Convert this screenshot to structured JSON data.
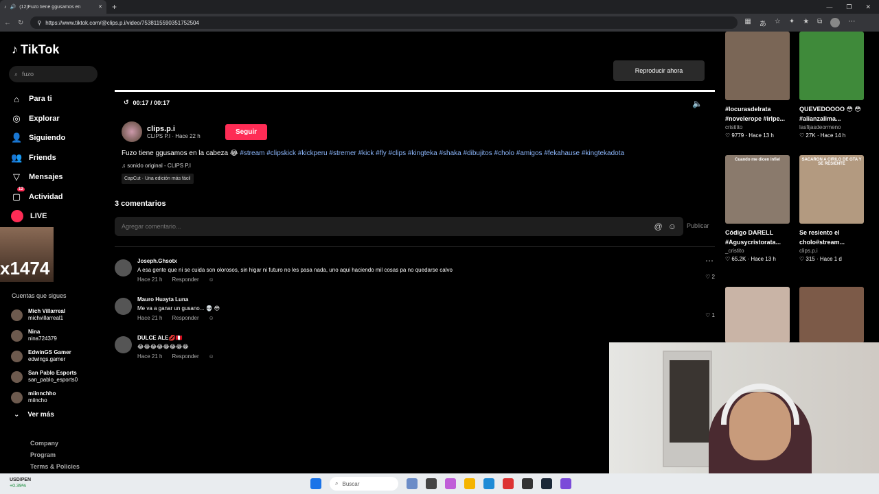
{
  "browser": {
    "tab_title": "(12)Fuzo tiene ggusamos en",
    "url": "https://www.tiktok.com/@clips.p.i/video/7538115590351752504"
  },
  "sidebar": {
    "logo": "TikTok",
    "search_placeholder": "fuzo",
    "nav": [
      {
        "label": "Para ti",
        "icon": "home-icon"
      },
      {
        "label": "Explorar",
        "icon": "compass-icon"
      },
      {
        "label": "Siguiendo",
        "icon": "following-icon"
      },
      {
        "label": "Friends",
        "icon": "friends-icon"
      },
      {
        "label": "Mensajes",
        "icon": "messages-icon"
      },
      {
        "label": "Actividad",
        "icon": "activity-icon",
        "badge": "12"
      },
      {
        "label": "LIVE",
        "icon": "live-icon"
      }
    ],
    "overlay_text": "x1474",
    "following_title": "Cuentas que sigues",
    "following": [
      {
        "name": "Mich Villarreal",
        "handle": "michvillarreal1"
      },
      {
        "name": "Nina",
        "handle": "nina724379"
      },
      {
        "name": "EdwinGS Gamer",
        "handle": "edwings.gamer"
      },
      {
        "name": "San Pablo Esports",
        "handle": "san_pablo_esports0"
      },
      {
        "name": "miinnchho",
        "handle": "miincho"
      }
    ],
    "see_more": "Ver más",
    "footer": [
      "Company",
      "Program",
      "Terms & Policies"
    ]
  },
  "video": {
    "play_now": "Reproducir ahora",
    "time": "00:17 / 00:17",
    "author_name": "clips.p.i",
    "author_sub": "CLIPS P.I · Hace 22 h",
    "follow_label": "Seguir",
    "desc_text": "Fuzo tiene ggusamos en la cabeza 😂",
    "desc_tags": "#stream #clipskick #kickperu #stremer #kick #fly #clips #kingteka #shaka #dibujitos #cholo #amigos #fekahause #kingtekadota",
    "sound": "♫ sonido original - CLIPS P.I",
    "capcut": "CapCut · Una edición más fácil"
  },
  "comments_section": {
    "count_label": "3 comentarios",
    "input_placeholder": "Agregar comentario...",
    "publish_label": "Publicar",
    "comments": [
      {
        "name": "Joseph.Ghsotx",
        "text": "A esa gente que ni se cuida son olorosos, sin higar ni futuro no les pasa nada, uno aqui haciendo mil cosas pa no quedarse calvo",
        "time": "Hace 21 h",
        "reply": "Responder",
        "likes": "2"
      },
      {
        "name": "Mauro Huayta Luna",
        "text": "Me va a ganar un gusano... 💀 😳",
        "time": "Hace 21 h",
        "reply": "Responder",
        "likes": "1"
      },
      {
        "name": "DULCE ALE💋🇵🇪",
        "text": "😂😂😂😂😂😂😂😂",
        "time": "Hace 21 h",
        "reply": "Responder",
        "likes": ""
      }
    ]
  },
  "feed": [
    {
      "title": "#locurasdelrata #novelerope #irlpe...",
      "author": "cristitto",
      "stats": "♡ 9779 · Hace 13 h",
      "color": "#7a6656"
    },
    {
      "title": "QUEVEDOOOO 😳 😳 #alianzalima...",
      "author": "lasfijasdeormeno",
      "stats": "♡ 27K · Hace 14 h",
      "color": "#3f8a3a"
    },
    {
      "title": "Código DARELL #Agusycristorata...",
      "author": "_cristito",
      "stats": "♡ 65.2K · Hace 13 h",
      "color": "#8a7a6c",
      "top": "Cuando me dicen infiel"
    },
    {
      "title": "Se resiento el cholo#stream...",
      "author": "clips.p.i",
      "stats": "♡ 315 · Hace 1 d",
      "color": "#b39a80",
      "top": "SACARON A CIRILO DE GTA Y SE RESIENTE"
    },
    {
      "title": "",
      "author": "",
      "stats": "",
      "color": "#c9b4a6"
    },
    {
      "title": "",
      "author": "",
      "stats": "",
      "color": "#7c5a48"
    }
  ],
  "taskbar": {
    "stock_name": "USD/PEN",
    "stock_change": "+0.39%",
    "search_label": "Buscar"
  }
}
